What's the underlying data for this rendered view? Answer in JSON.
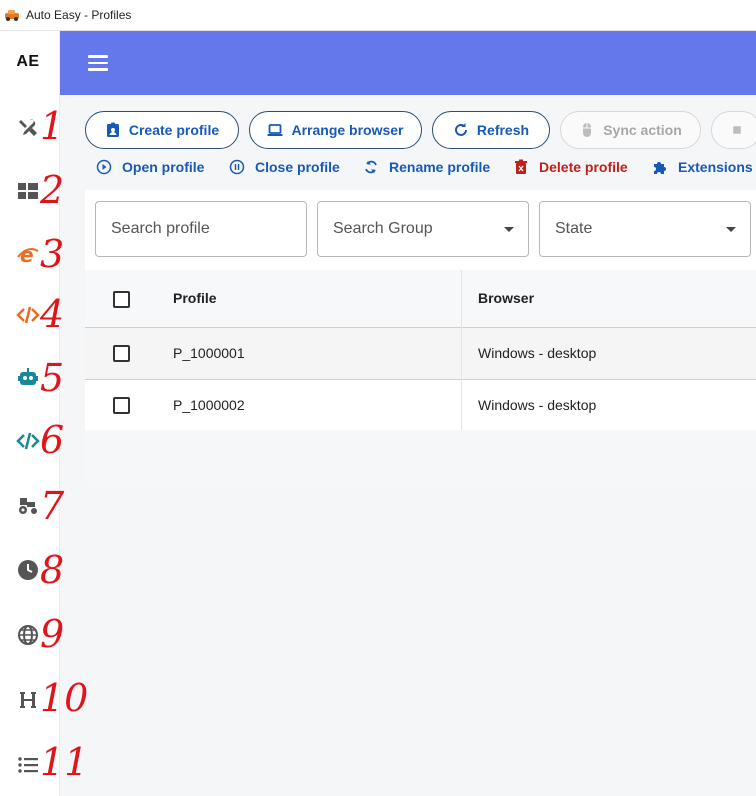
{
  "window": {
    "title": "Auto Easy - Profiles"
  },
  "sidebar": {
    "logo": "AE",
    "items": [
      {
        "icon": "tools-icon",
        "num": "1"
      },
      {
        "icon": "dashboard-icon",
        "num": "2"
      },
      {
        "icon": "browser-e-icon",
        "num": "3"
      },
      {
        "icon": "code-icon",
        "num": "4"
      },
      {
        "icon": "robot-icon",
        "num": "5"
      },
      {
        "icon": "code-teal-icon",
        "num": "6"
      },
      {
        "icon": "tractor-icon",
        "num": "7"
      },
      {
        "icon": "clock-icon",
        "num": "8"
      },
      {
        "icon": "globe-icon",
        "num": "9"
      },
      {
        "icon": "heading-icon",
        "num": "10"
      },
      {
        "icon": "list-icon",
        "num": "11"
      }
    ]
  },
  "toolbar": {
    "create": "Create profile",
    "arrange": "Arrange browser",
    "refresh": "Refresh",
    "sync": "Sync action"
  },
  "actions": {
    "open": "Open profile",
    "close": "Close profile",
    "rename": "Rename profile",
    "delete": "Delete profile",
    "extensions": "Extensions"
  },
  "filters": {
    "search_profile": "Search profile",
    "search_group": "Search Group",
    "state": "State"
  },
  "table": {
    "headers": [
      "Profile",
      "Browser"
    ],
    "rows": [
      {
        "profile": "P_1000001",
        "browser": "Windows - desktop"
      },
      {
        "profile": "P_1000002",
        "browser": "Windows - desktop"
      }
    ]
  },
  "colors": {
    "appbar": "#6478ec",
    "link": "#1859b8",
    "danger": "#c0201a",
    "annotation": "#e0141b"
  }
}
